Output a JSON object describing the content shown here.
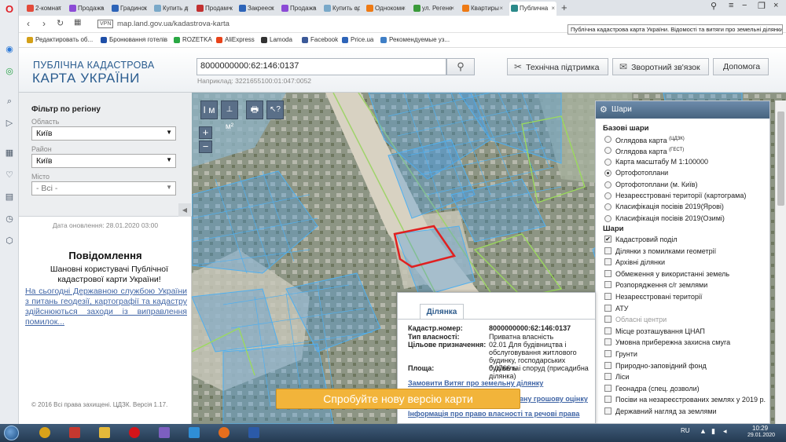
{
  "browser": {
    "tabs": [
      {
        "title": "2-комнат",
        "color": "#e34a3a"
      },
      {
        "title": "Продажа",
        "color": "#8c4bd6"
      },
      {
        "title": "Градинск",
        "color": "#2d64b8"
      },
      {
        "title": "Купить д",
        "color": "#7aa9c9"
      },
      {
        "title": "Продам к",
        "color": "#c23030"
      },
      {
        "title": "Закрееск",
        "color": "#2d64b8"
      },
      {
        "title": "Продажа",
        "color": "#8c4bd6"
      },
      {
        "title": "Купить од",
        "color": "#7aa9c9"
      },
      {
        "title": "Однокомн",
        "color": "#ee7a14"
      },
      {
        "title": "ул. Регене",
        "color": "#3a9a3a"
      },
      {
        "title": "Квартиры",
        "color": "#ee7a14"
      },
      {
        "title": "Публична",
        "color": "#2b8a8a"
      }
    ],
    "vpn": "VPN",
    "url": "map.land.gov.ua/kadastrova-karta",
    "tooltip": "Публічна кадастрова карта України. Відомості та витяги про земельні ділянки.",
    "bookmarks": [
      {
        "label": "Редактировать об...",
        "color": "#d4a017"
      },
      {
        "label": "Бронювання готелів",
        "color": "#1f4fa8"
      },
      {
        "label": "ROZETKA",
        "color": "#2aa844"
      },
      {
        "label": "AliExpress",
        "color": "#e8431a"
      },
      {
        "label": "Lamoda",
        "color": "#333333"
      },
      {
        "label": "Facebook",
        "color": "#3b5998"
      },
      {
        "label": "Price.ua",
        "color": "#2e64b8"
      },
      {
        "label": "Рекомендуемые уз...",
        "color": "#3f7fc6"
      }
    ]
  },
  "header": {
    "logo_line1": "ПУБЛІЧНА КАДАСТРОВА",
    "logo_line2": "КАРТА УКРАЇНИ",
    "search_value": "8000000000:62:146:0137",
    "search_hint": "Наприклад: 3221655100:01:047:0052",
    "support_btn": "Технічна підтримка",
    "feedback_btn": "Зворотний зв'язок",
    "help_btn": "Допомога"
  },
  "filter": {
    "title": "Фільтр по регіону",
    "oblast_label": "Область",
    "oblast_value": "Київ",
    "raion_label": "Район",
    "raion_value": "Київ",
    "misto_label": "Місто",
    "misto_value": "- Всі -"
  },
  "left": {
    "updated": "Дата оновлення: 28.01.2020 03:00",
    "notice_title": "Повідомлення",
    "notice_body": "Шановні користувачі Публічної кадастрової карти України!",
    "notice_link": "На сьогодні Державною службою України з питань геодезії, картографії та кадастру здійснюються заходи із виправлення помилок...",
    "copyright": "© 2016 Всі права захищені. ЦДЗК. Версія 1.17."
  },
  "map": {
    "tools": [
      "I м",
      "⊥ м²",
      "🖶",
      "↖?"
    ],
    "zoom_in": "+",
    "zoom_out": "−",
    "parcel_color": "#e02020",
    "cadastre_color": "#2a7ad8"
  },
  "layers": {
    "title": "Шари",
    "base_title": "Базові шари",
    "base": [
      {
        "label": "Оглядова карта",
        "sup": "(ЦДЗК)",
        "on": false
      },
      {
        "label": "Оглядова карта",
        "sup": "(ГЕСТ)",
        "on": false
      },
      {
        "label": "Карта масштабу М 1:100000",
        "sup": "",
        "on": false
      },
      {
        "label": "Ортофотоплани",
        "sup": "",
        "on": true
      },
      {
        "label": "Ортофотоплани (м. Київ)",
        "sup": "",
        "on": false
      },
      {
        "label": "Незареєстровані території (картограма)",
        "sup": "",
        "on": false
      },
      {
        "label": "Класифікація посівів 2019(Ярові)",
        "sup": "",
        "on": false
      },
      {
        "label": "Класифікація посівів 2019(Озимі)",
        "sup": "",
        "on": false
      }
    ],
    "over_title": "Шари",
    "over": [
      {
        "label": "Кадастровий поділ",
        "on": true,
        "disabled": false
      },
      {
        "label": "Ділянки з помилками геометрії",
        "on": false,
        "disabled": false
      },
      {
        "label": "Архівні ділянки",
        "on": false,
        "disabled": false
      },
      {
        "label": "Обмеження у використанні земель",
        "on": false,
        "disabled": false
      },
      {
        "label": "Розпорядження с/г землями",
        "on": false,
        "disabled": false
      },
      {
        "label": "Незареєстровані території",
        "on": false,
        "disabled": false
      },
      {
        "label": "АТУ",
        "on": false,
        "disabled": false
      },
      {
        "label": "Обласні центри",
        "on": false,
        "disabled": true
      },
      {
        "label": "Місце розташування ЦНАП",
        "on": false,
        "disabled": false
      },
      {
        "label": "Умовна прибережна захисна смуга",
        "on": false,
        "disabled": false
      },
      {
        "label": "Грунти",
        "on": false,
        "disabled": false
      },
      {
        "label": "Природно-заповідний фонд",
        "on": false,
        "disabled": false
      },
      {
        "label": "Ліси",
        "on": false,
        "disabled": false
      },
      {
        "label": "Геонадра (спец. дозволи)",
        "on": false,
        "disabled": false
      },
      {
        "label": "Посіви на незареєстрованих землях у 2019 р.",
        "on": false,
        "disabled": false
      },
      {
        "label": "Державний нагляд за землями",
        "on": false,
        "disabled": false
      }
    ]
  },
  "parcel": {
    "tab": "Ділянка",
    "rows": [
      {
        "k": "Кадастр.номер:",
        "v": "8000000000:62:146:0137"
      },
      {
        "k": "Тип власності:",
        "v": "Приватна власність"
      },
      {
        "k": "Цільове призначення:",
        "v": "02.01 Для будівництва і обслуговування житлового будинку, господарських будівель і споруд (присадибна ділянка)"
      },
      {
        "k": "Площа:",
        "v": "0.0766 га"
      }
    ],
    "link1": "Замовити Витяг про земельну ділянку",
    "link2": "...рмативну грошову оцінку",
    "link3": "Інформація про право власності та речові права"
  },
  "promo": "Спробуйте нову версію карти",
  "taskbar": {
    "lang": "RU",
    "time": "10:29",
    "date": "29.01.2020",
    "apps": [
      {
        "name": "chrome",
        "color": "#d8a21a"
      },
      {
        "name": "aggregator",
        "color": "#c6382f"
      },
      {
        "name": "explorer",
        "color": "#e5b93a"
      },
      {
        "name": "opera",
        "color": "#d4141a"
      },
      {
        "name": "viber",
        "color": "#7d5fc0"
      },
      {
        "name": "ie",
        "color": "#2f8ed6"
      },
      {
        "name": "firefox",
        "color": "#e66e1d"
      },
      {
        "name": "word",
        "color": "#2b5aa8"
      }
    ]
  }
}
